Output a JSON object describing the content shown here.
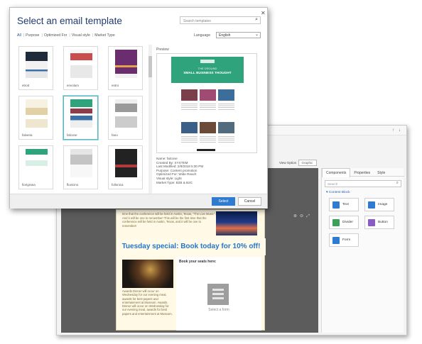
{
  "dialog": {
    "title": "Select an email template",
    "search_placeholder": "Search templates",
    "filters": [
      "All",
      "Purpose",
      "Optimized For",
      "Visual style",
      "Market Type"
    ],
    "language_label": "Language",
    "language_value": "English",
    "templates": [
      {
        "name": "etroit"
      },
      {
        "name": "envolum"
      },
      {
        "name": "entro"
      },
      {
        "name": "falveria"
      },
      {
        "name": "falcone"
      },
      {
        "name": "fano"
      },
      {
        "name": "fiorigrana"
      },
      {
        "name": "fluvicino"
      },
      {
        "name": "follonica"
      }
    ],
    "selected_template": "falcone",
    "preview_label": "Preview",
    "preview": {
      "header_small": "THE GROUND",
      "header_title": "SMALL BUSINESS THOUGHT"
    },
    "details": [
      "Name: falcone",
      "Created By: SYSTEM",
      "Last Modified: 2/9/2018 5:30 PM",
      "Purpose: Content promotion",
      "Optimized For: Wide Reach",
      "Visual style: Light",
      "Market Type: B2B & B2C"
    ],
    "select_label": "Select",
    "cancel_label": "Cancel"
  },
  "designer": {
    "view_option_label": "View Option",
    "view_option_value": "Graphic",
    "email": {
      "intro_text": "time that the conference will be held in Austin, Texas, \"The Live Music\". And it will be one to remember! This will be the first time that the conference will be held in Austin, Texas, and it will be one to remember!",
      "headline": "Tuesday special: Book today for 10% off!",
      "book_label": "Book your seats here:",
      "form_placeholder": "Select a form",
      "event_text": "Awards Dinner will occur on Wednesday for our evening meal, awards for best papers and entertainment at Museum. Awards Dinner will occur on Wednesday for our evening meal, awards for best papers and entertainment at Museum."
    },
    "panel": {
      "tabs": [
        "Components",
        "Properties",
        "Style"
      ],
      "search_placeholder": "Search",
      "section_label": "Content Block",
      "components": [
        {
          "label": "Text",
          "color": "#2e7bcf"
        },
        {
          "label": "Image",
          "color": "#2e7bcf"
        },
        {
          "label": "Divider",
          "color": "#3aa05a"
        },
        {
          "label": "Button",
          "color": "#8a5bc4"
        },
        {
          "label": "Form",
          "color": "#2e7bcf"
        }
      ]
    }
  }
}
